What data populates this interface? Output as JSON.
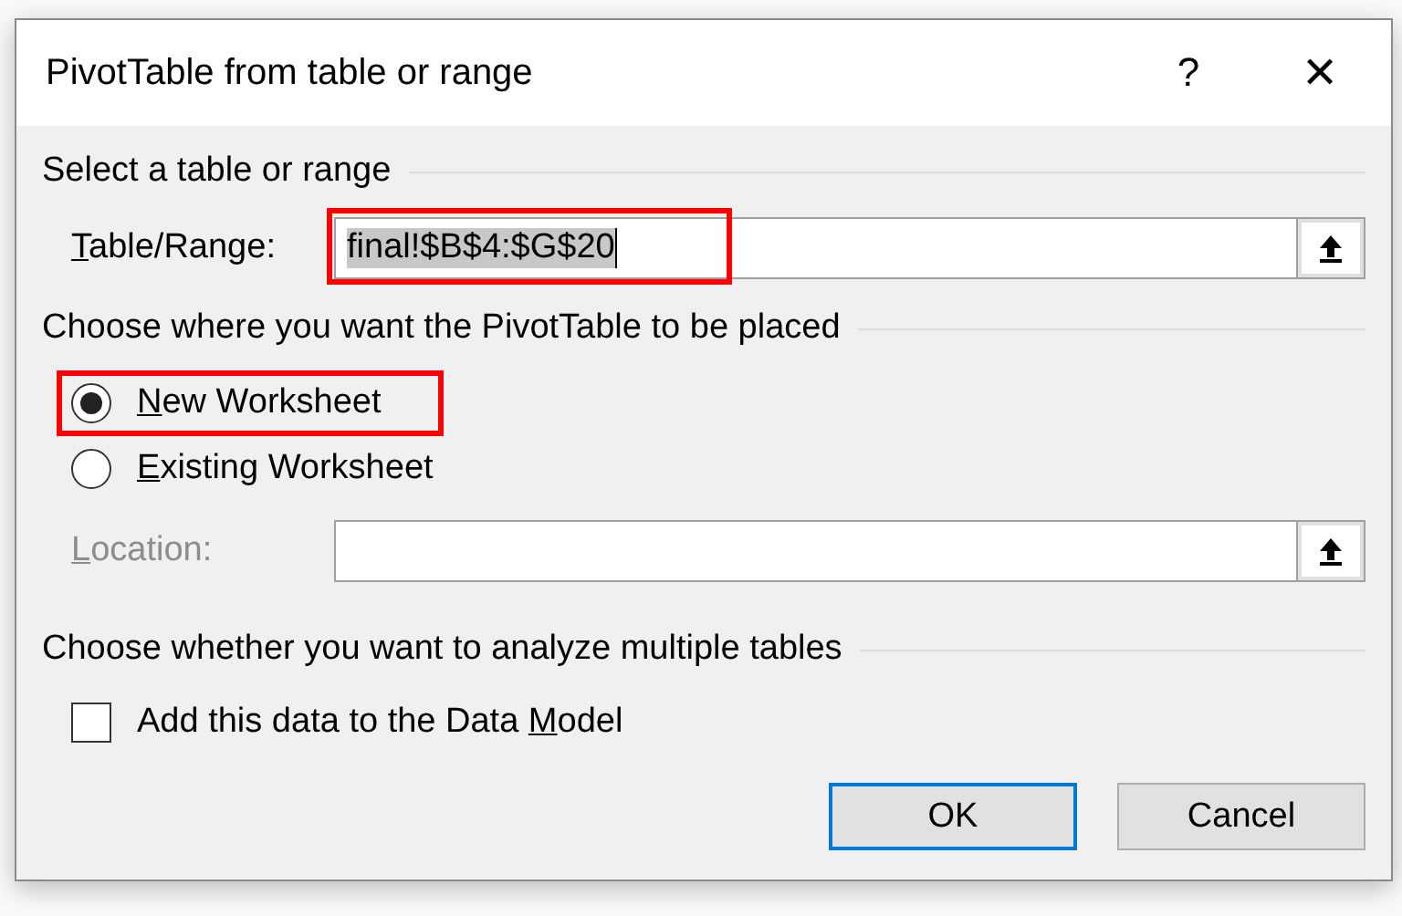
{
  "window": {
    "title": "PivotTable from table or range",
    "help": "?",
    "close": "✕"
  },
  "source": {
    "heading": "Select a table or range",
    "label": [
      {
        "text": "T",
        "underlined": true
      },
      {
        "text": "able/Range:",
        "underlined": false
      }
    ],
    "value": "final!$B$4:$G$20",
    "text_selected": true,
    "highlighted": true
  },
  "placement": {
    "heading": "Choose where you want the PivotTable to be placed",
    "options": [
      {
        "label": [
          {
            "text": "N",
            "underlined": true
          },
          {
            "text": "ew Worksheet",
            "underlined": false
          }
        ],
        "selected": true,
        "highlighted": true
      },
      {
        "label": [
          {
            "text": "E",
            "underlined": true
          },
          {
            "text": "xisting Worksheet",
            "underlined": false
          }
        ],
        "selected": false,
        "highlighted": false
      }
    ],
    "location": {
      "label": [
        {
          "text": "L",
          "underlined": true
        },
        {
          "text": "ocation:",
          "underlined": false
        }
      ],
      "disabled": true
    }
  },
  "multiple": {
    "heading": "Choose whether you want to analyze multiple tables",
    "checkbox": {
      "label": [
        {
          "text": "Add this data to the Data ",
          "underlined": false
        },
        {
          "text": "M",
          "underlined": true
        },
        {
          "text": "odel",
          "underlined": false
        }
      ],
      "checked": false
    }
  },
  "buttons": [
    {
      "label": "OK",
      "default": true
    },
    {
      "label": "Cancel",
      "default": false
    }
  ]
}
